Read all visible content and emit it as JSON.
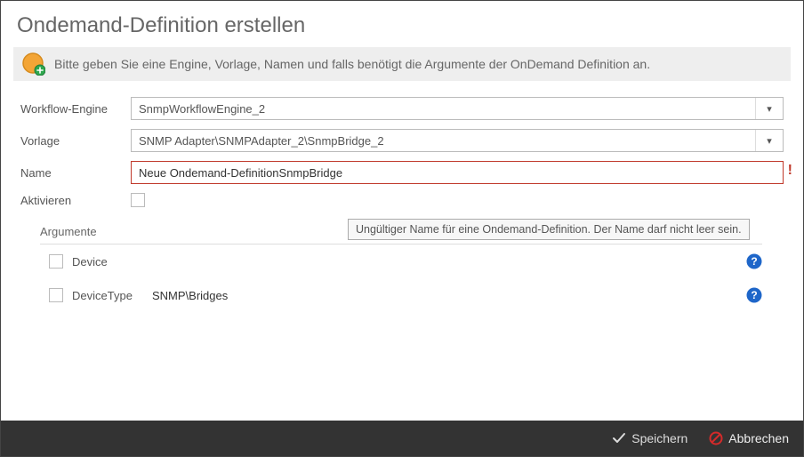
{
  "title": "Ondemand-Definition erstellen",
  "info_text": "Bitte geben Sie eine Engine, Vorlage, Namen und falls benötigt die Argumente der OnDemand Definition an.",
  "labels": {
    "workflow_engine": "Workflow-Engine",
    "template": "Vorlage",
    "name": "Name",
    "activate": "Aktivieren",
    "arguments": "Argumente"
  },
  "values": {
    "workflow_engine": "SnmpWorkflowEngine_2",
    "template": "SNMP Adapter\\SNMPAdapter_2\\SnmpBridge_2",
    "name": "Neue Ondemand-DefinitionSnmpBridge",
    "activate_checked": false
  },
  "validation": {
    "name_error": "Ungültiger Name für eine Ondemand-Definition. Der Name darf nicht leer sein."
  },
  "arguments": [
    {
      "label": "Device",
      "value": "",
      "checked": false
    },
    {
      "label": "DeviceType",
      "value": "SNMP\\Bridges",
      "checked": false
    }
  ],
  "footer": {
    "save": "Speichern",
    "cancel": "Abbrechen"
  }
}
